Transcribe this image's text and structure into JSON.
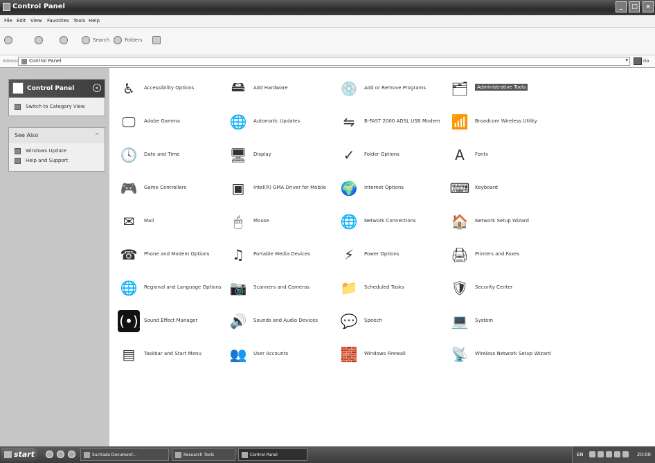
{
  "window": {
    "title": "Control Panel",
    "buttons": {
      "minimize": "_",
      "maximize": "□",
      "close": "×"
    }
  },
  "menu": [
    "File",
    "Edit",
    "View",
    "Favorites",
    "Tools",
    "Help"
  ],
  "toolbar": {
    "search": "Search",
    "folders": "Folders"
  },
  "address": {
    "label": "Address",
    "value": "Control Panel",
    "go": "Go"
  },
  "sidebar": {
    "panel_title": "Control Panel",
    "switch_view": "Switch to Category View",
    "see_also_title": "See Also",
    "see_also_items": [
      "Windows Update",
      "Help and Support"
    ]
  },
  "items": [
    {
      "label": "Accessibility Options",
      "icon": "accessibility-icon"
    },
    {
      "label": "Add Hardware",
      "icon": "add-hardware-icon"
    },
    {
      "label": "Add or Remove Programs",
      "icon": "add-remove-programs-icon"
    },
    {
      "label": "Administrative Tools",
      "icon": "administrative-tools-icon"
    },
    {
      "label": "Adobe Gamma",
      "icon": "adobe-gamma-icon"
    },
    {
      "label": "Automatic Updates",
      "icon": "automatic-updates-icon"
    },
    {
      "label": "B-FAST 2000 ADSL USB Modem",
      "icon": "modem-icon"
    },
    {
      "label": "Broadcom Wireless Utility",
      "icon": "wireless-utility-icon"
    },
    {
      "label": "Date and Time",
      "icon": "date-time-icon"
    },
    {
      "label": "Display",
      "icon": "display-icon"
    },
    {
      "label": "Folder Options",
      "icon": "folder-options-icon"
    },
    {
      "label": "Fonts",
      "icon": "fonts-icon"
    },
    {
      "label": "Game Controllers",
      "icon": "game-controllers-icon"
    },
    {
      "label": "Intel(R) GMA Driver for Mobile",
      "icon": "intel-gma-icon"
    },
    {
      "label": "Internet Options",
      "icon": "internet-options-icon"
    },
    {
      "label": "Keyboard",
      "icon": "keyboard-icon"
    },
    {
      "label": "Mail",
      "icon": "mail-icon"
    },
    {
      "label": "Mouse",
      "icon": "mouse-icon"
    },
    {
      "label": "Network Connections",
      "icon": "network-connections-icon"
    },
    {
      "label": "Network Setup Wizard",
      "icon": "network-setup-icon"
    },
    {
      "label": "Phone and Modem Options",
      "icon": "phone-modem-icon"
    },
    {
      "label": "Portable Media Devices",
      "icon": "portable-media-icon"
    },
    {
      "label": "Power Options",
      "icon": "power-options-icon"
    },
    {
      "label": "Printers and Faxes",
      "icon": "printers-faxes-icon"
    },
    {
      "label": "Regional and Language Options",
      "icon": "regional-language-icon"
    },
    {
      "label": "Scanners and Cameras",
      "icon": "scanners-cameras-icon"
    },
    {
      "label": "Scheduled Tasks",
      "icon": "scheduled-tasks-icon"
    },
    {
      "label": "Security Center",
      "icon": "security-center-icon"
    },
    {
      "label": "Sound Effect Manager",
      "icon": "sound-effect-icon"
    },
    {
      "label": "Sounds and Audio Devices",
      "icon": "sounds-audio-icon"
    },
    {
      "label": "Speech",
      "icon": "speech-icon"
    },
    {
      "label": "System",
      "icon": "system-icon"
    },
    {
      "label": "Taskbar and Start Menu",
      "icon": "taskbar-start-icon"
    },
    {
      "label": "User Accounts",
      "icon": "user-accounts-icon"
    },
    {
      "label": "Windows Firewall",
      "icon": "firewall-icon"
    },
    {
      "label": "Wireless Network Setup Wizard",
      "icon": "wireless-setup-icon"
    }
  ],
  "taskbar": {
    "start": "start",
    "tasks": [
      "Suchada Document...",
      "Research Tools",
      "Control Panel"
    ],
    "tray": {
      "lang": "EN",
      "clock": "20:00"
    }
  }
}
